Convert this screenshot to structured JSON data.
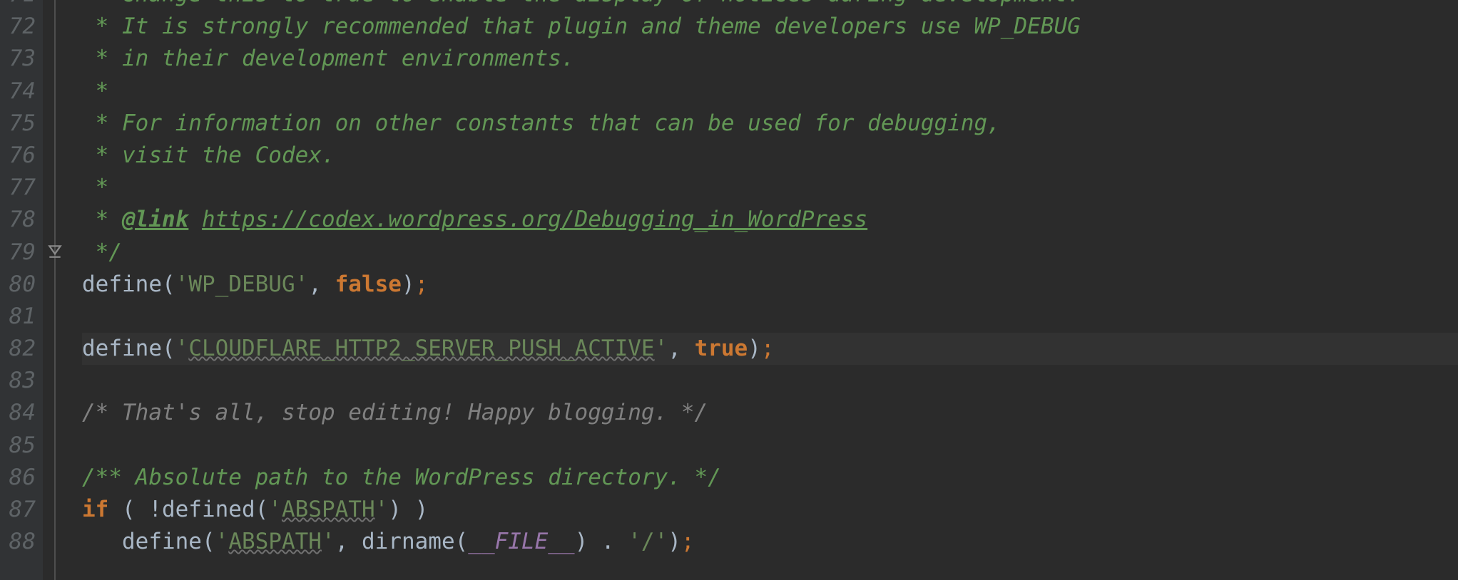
{
  "gutter": {
    "start": 71,
    "end": 88
  },
  "highlight_line": 82,
  "fold_marker_line": 79,
  "lines": {
    "71": [
      {
        "cls": "tok-doc",
        "txt": " * Change this to true to enable the display of notices during development."
      }
    ],
    "72": [
      {
        "cls": "tok-doc",
        "txt": " * It is strongly recommended that plugin and theme developers use WP_DEBUG"
      }
    ],
    "73": [
      {
        "cls": "tok-doc",
        "txt": " * in their development environments."
      }
    ],
    "74": [
      {
        "cls": "tok-doc",
        "txt": " *"
      }
    ],
    "75": [
      {
        "cls": "tok-doc",
        "txt": " * For information on other constants that can be used for debugging,"
      }
    ],
    "76": [
      {
        "cls": "tok-doc",
        "txt": " * visit the Codex."
      }
    ],
    "77": [
      {
        "cls": "tok-doc",
        "txt": " *"
      }
    ],
    "78": [
      {
        "cls": "tok-doc",
        "txt": " * "
      },
      {
        "cls": "tok-doc-tag",
        "txt": "@link"
      },
      {
        "cls": "tok-doc",
        "txt": " "
      },
      {
        "cls": "tok-doc-link",
        "txt": "https://codex.wordpress.org/Debugging_in_WordPress"
      }
    ],
    "79": [
      {
        "cls": "tok-doc",
        "txt": " */"
      }
    ],
    "80": [
      {
        "cls": "tok-default",
        "txt": "define("
      },
      {
        "cls": "tok-string",
        "txt": "'WP_DEBUG'"
      },
      {
        "cls": "tok-default",
        "txt": ", "
      },
      {
        "cls": "tok-keyword",
        "txt": "false"
      },
      {
        "cls": "tok-default",
        "txt": ")"
      },
      {
        "cls": "tok-semi",
        "txt": ";"
      }
    ],
    "81": [],
    "82": [
      {
        "cls": "tok-default",
        "txt": "define("
      },
      {
        "cls": "tok-string",
        "txt": "'"
      },
      {
        "cls": "wavy-str",
        "txt": "CLOUDFLARE_HTTP2_SERVER_PUSH_ACTIVE"
      },
      {
        "cls": "tok-string",
        "txt": "'"
      },
      {
        "cls": "tok-default",
        "txt": ", "
      },
      {
        "cls": "tok-keyword",
        "txt": "true"
      },
      {
        "cls": "tok-default",
        "txt": ")"
      },
      {
        "cls": "tok-semi",
        "txt": ";"
      }
    ],
    "83": [],
    "84": [
      {
        "cls": "tok-comment",
        "txt": "/* That's all, stop editing! Happy blogging. */"
      }
    ],
    "85": [],
    "86": [
      {
        "cls": "tok-doc",
        "txt": "/** Absolute path to the WordPress directory. */"
      }
    ],
    "87": [
      {
        "cls": "tok-keyword",
        "txt": "if"
      },
      {
        "cls": "tok-default",
        "txt": " ( !defined("
      },
      {
        "cls": "tok-string",
        "txt": "'"
      },
      {
        "cls": "wavy-str",
        "txt": "ABSPATH"
      },
      {
        "cls": "tok-string",
        "txt": "'"
      },
      {
        "cls": "tok-default",
        "txt": ") )"
      }
    ],
    "88": [
      {
        "cls": "tok-default",
        "txt": "   define("
      },
      {
        "cls": "tok-string",
        "txt": "'"
      },
      {
        "cls": "wavy-str",
        "txt": "ABSPATH"
      },
      {
        "cls": "tok-string",
        "txt": "'"
      },
      {
        "cls": "tok-default",
        "txt": ", dirname("
      },
      {
        "cls": "tok-magic",
        "txt": "__FILE__"
      },
      {
        "cls": "tok-default",
        "txt": ") . "
      },
      {
        "cls": "tok-string",
        "txt": "'/'"
      },
      {
        "cls": "tok-default",
        "txt": ")"
      },
      {
        "cls": "tok-semi",
        "txt": ";"
      }
    ]
  }
}
